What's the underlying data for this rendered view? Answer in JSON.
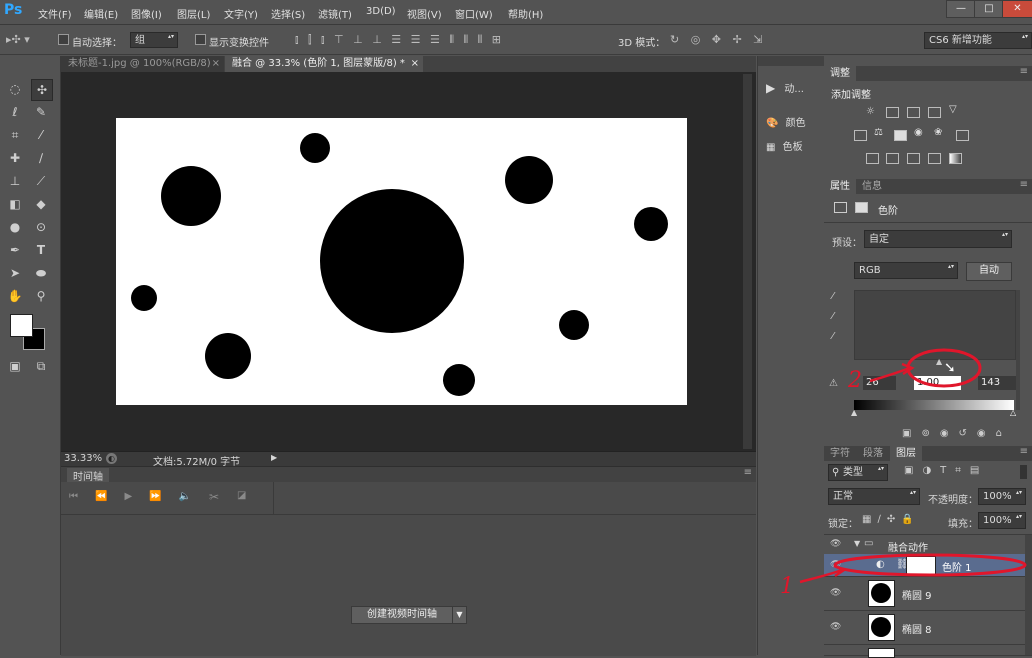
{
  "app": {
    "logo": "Ps"
  },
  "menu": [
    "文件(F)",
    "编辑(E)",
    "图像(I)",
    "图层(L)",
    "文字(Y)",
    "选择(S)",
    "滤镜(T)",
    "3D(D)",
    "视图(V)",
    "窗口(W)",
    "帮助(H)"
  ],
  "window_buttons": [
    "—",
    "□",
    "✕"
  ],
  "options": {
    "auto_select_label": "自动选择：",
    "auto_select_value": "组",
    "show_transform_label": "显示变换控件",
    "mode3d_label": "3D 模式：",
    "workspace": "CS6 新增功能"
  },
  "tabs": [
    {
      "label": "未标题-1.jpg @ 100%(RGB/8)",
      "close": "×"
    },
    {
      "label": "融合 @ 33.3% (色阶 1, 图层蒙版/8) *",
      "close": "×"
    }
  ],
  "status": {
    "zoom": "33.33%",
    "doc": "文档:5.72M/0 字节"
  },
  "timeline": {
    "title": "时间轴",
    "create_button": "创建视频时间轴"
  },
  "mid_panel": [
    {
      "icon": "play-icon",
      "label": "动..."
    },
    {
      "icon": "palette-icon",
      "label": "颜色"
    },
    {
      "icon": "swatches-icon",
      "label": "色板"
    }
  ],
  "adjustments": {
    "tab": "调整",
    "title": "添加调整"
  },
  "properties": {
    "tabs": [
      "属性",
      "信息"
    ],
    "title": "色阶",
    "preset_label": "预设：",
    "preset_value": "自定",
    "channel": "RGB",
    "auto_button": "自动",
    "input_low": "26",
    "input_mid": "1.00",
    "input_high": "143"
  },
  "layers": {
    "tabs": [
      "字符",
      "段落",
      "图层"
    ],
    "filter_kind": "类型",
    "blend_mode": "正常",
    "opacity_label": "不透明度：",
    "opacity": "100%",
    "lock_label": "锁定：",
    "fill_label": "填充：",
    "fill": "100%",
    "group_name": "融合动作",
    "rows": [
      {
        "name": "色阶 1",
        "selected": true
      },
      {
        "name": "椭圆 9",
        "selected": false
      },
      {
        "name": "椭圆 8",
        "selected": false
      }
    ]
  },
  "annotations": {
    "one": "1",
    "two": "2"
  }
}
